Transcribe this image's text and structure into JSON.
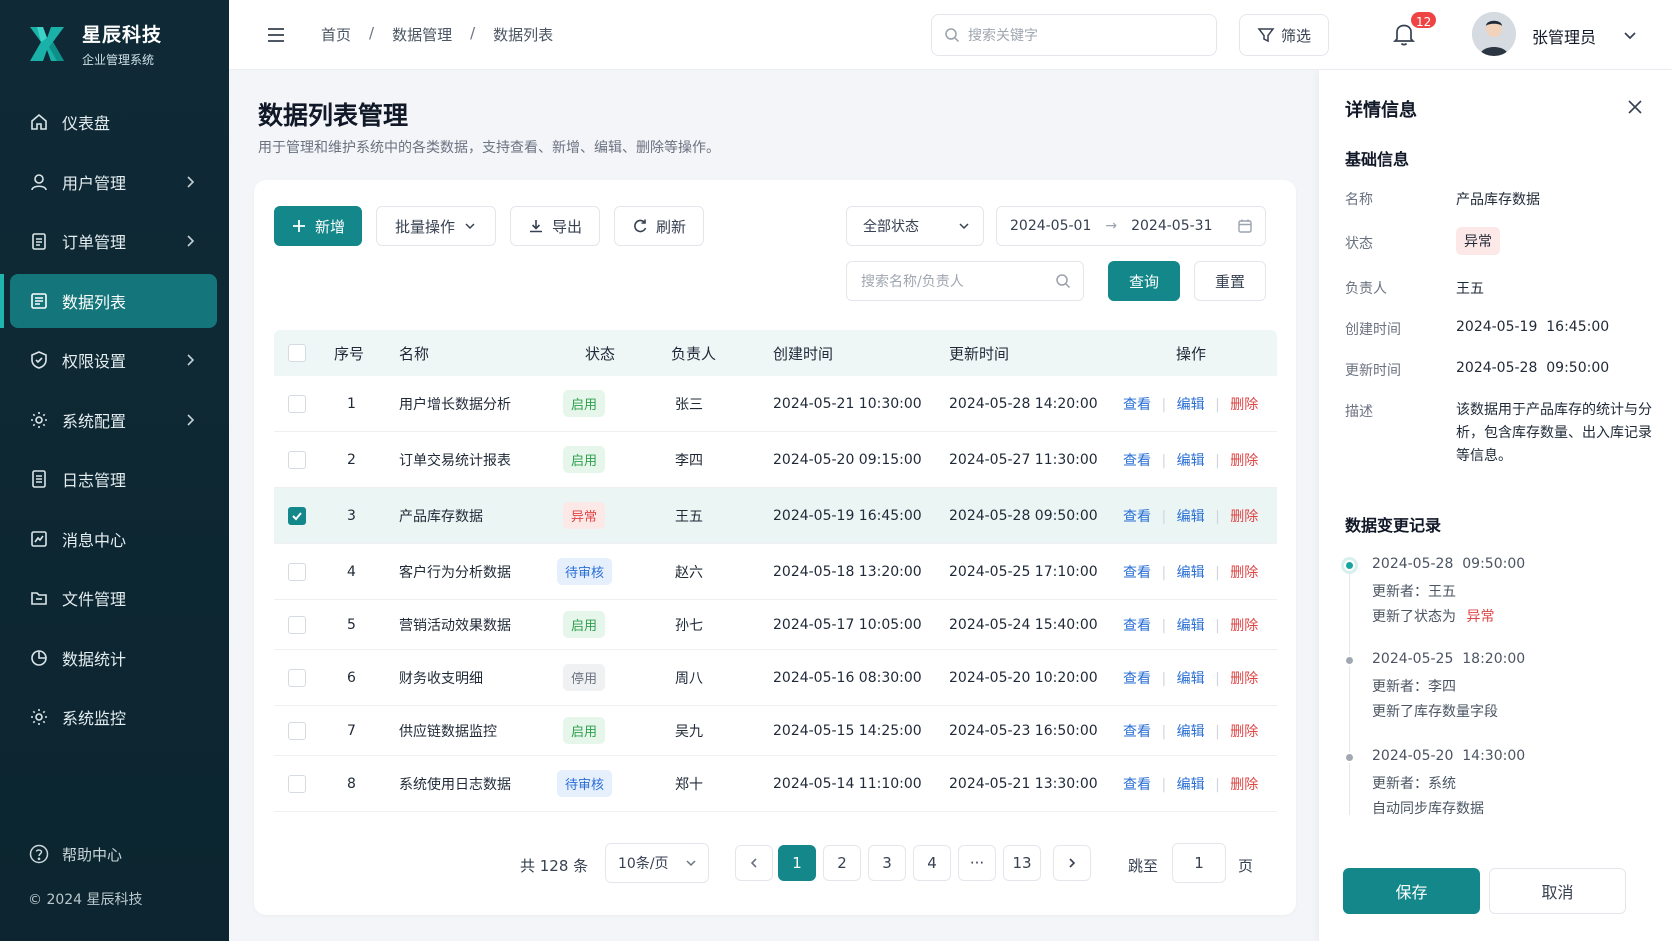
{
  "brand": {
    "name": "星辰科技",
    "subtitle": "企业管理系统"
  },
  "sidebar": {
    "items": [
      {
        "label": "仪表盘",
        "icon": "home-icon",
        "has_children": false,
        "active": false
      },
      {
        "label": "用户管理",
        "icon": "user-icon",
        "has_children": true,
        "active": false
      },
      {
        "label": "订单管理",
        "icon": "clipboard-icon",
        "has_children": true,
        "active": false
      },
      {
        "label": "数据列表",
        "icon": "list-icon",
        "has_children": false,
        "active": true
      },
      {
        "label": "权限设置",
        "icon": "shield-icon",
        "has_children": true,
        "active": false
      },
      {
        "label": "系统配置",
        "icon": "gear-icon",
        "has_children": true,
        "active": false
      },
      {
        "label": "日志管理",
        "icon": "document-icon",
        "has_children": false,
        "active": false
      },
      {
        "label": "消息中心",
        "icon": "chart-line-icon",
        "has_children": false,
        "active": false
      },
      {
        "label": "文件管理",
        "icon": "folder-icon",
        "has_children": false,
        "active": false
      },
      {
        "label": "数据统计",
        "icon": "pie-chart-icon",
        "has_children": false,
        "active": false
      },
      {
        "label": "系统监控",
        "icon": "monitor-gear-icon",
        "has_children": false,
        "active": false
      }
    ],
    "help_label": "帮助中心",
    "copyright": "© 2024 星辰科技"
  },
  "header": {
    "breadcrumb": [
      "首页",
      "数据管理",
      "数据列表"
    ],
    "search_placeholder": "搜索关键字",
    "filter_label": "筛选",
    "notification_count": "12",
    "user_name": "张管理员"
  },
  "page": {
    "title": "数据列表管理",
    "description": "用于管理和维护系统中的各类数据，支持查看、新增、编辑、删除等操作。"
  },
  "toolbar": {
    "add_label": "新增",
    "batch_label": "批量操作",
    "export_label": "导出",
    "refresh_label": "刷新",
    "status_select": "全部状态",
    "date_start": "2024-05-01",
    "date_end": "2024-05-31",
    "search_placeholder": "搜索名称/负责人",
    "query_label": "查询",
    "reset_label": "重置"
  },
  "table": {
    "columns": [
      "序号",
      "名称",
      "状态",
      "负责人",
      "创建时间",
      "更新时间",
      "操作"
    ],
    "actions": {
      "view": "查看",
      "edit": "编辑",
      "delete": "删除"
    },
    "rows": [
      {
        "index": "1",
        "name": "用户增长数据分析",
        "status": "启用",
        "status_type": "green",
        "owner": "张三",
        "created": "2024-05-21 10:30:00",
        "updated": "2024-05-28 14:20:00",
        "checked": false
      },
      {
        "index": "2",
        "name": "订单交易统计报表",
        "status": "启用",
        "status_type": "green",
        "owner": "李四",
        "created": "2024-05-20 09:15:00",
        "updated": "2024-05-27 11:30:00",
        "checked": false
      },
      {
        "index": "3",
        "name": "产品库存数据",
        "status": "异常",
        "status_type": "red",
        "owner": "王五",
        "created": "2024-05-19 16:45:00",
        "updated": "2024-05-28 09:50:00",
        "checked": true
      },
      {
        "index": "4",
        "name": "客户行为分析数据",
        "status": "待审核",
        "status_type": "blue",
        "owner": "赵六",
        "created": "2024-05-18 13:20:00",
        "updated": "2024-05-25 17:10:00",
        "checked": false
      },
      {
        "index": "5",
        "name": "营销活动效果数据",
        "status": "启用",
        "status_type": "green",
        "owner": "孙七",
        "created": "2024-05-17 10:05:00",
        "updated": "2024-05-24 15:40:00",
        "checked": false
      },
      {
        "index": "6",
        "name": "财务收支明细",
        "status": "停用",
        "status_type": "gray",
        "owner": "周八",
        "created": "2024-05-16 08:30:00",
        "updated": "2024-05-20 10:20:00",
        "checked": false
      },
      {
        "index": "7",
        "name": "供应链数据监控",
        "status": "启用",
        "status_type": "green",
        "owner": "吴九",
        "created": "2024-05-15 14:25:00",
        "updated": "2024-05-23 16:50:00",
        "checked": false
      },
      {
        "index": "8",
        "name": "系统使用日志数据",
        "status": "待审核",
        "status_type": "blue",
        "owner": "郑十",
        "created": "2024-05-14 11:10:00",
        "updated": "2024-05-21 13:30:00",
        "checked": false
      }
    ]
  },
  "pagination": {
    "total_text": "共 128 条",
    "page_size": "10条/页",
    "pages": [
      "1",
      "2",
      "3",
      "4",
      "···",
      "13"
    ],
    "current": "1",
    "jump_label": "跳至",
    "jump_value": "1",
    "jump_unit": "页"
  },
  "detail": {
    "title": "详情信息",
    "basic_title": "基础信息",
    "fields": [
      {
        "label": "名称",
        "value": "产品库存数据"
      },
      {
        "label": "状态",
        "value": "异常"
      },
      {
        "label": "负责人",
        "value": "王五"
      },
      {
        "label": "创建时间",
        "value": "2024-05-19  16:45:00"
      },
      {
        "label": "更新时间",
        "value": "2024-05-28  09:50:00"
      },
      {
        "label": "描述",
        "value": "该数据用于产品库存的统计与分析，包含库存数量、出入库记录等信息。"
      }
    ],
    "history_title": "数据变更记录",
    "history": [
      {
        "time": "2024-05-28  09:50:00",
        "updater": "更新者：王五",
        "change": "更新了状态为",
        "change_highlight": "异常"
      },
      {
        "time": "2024-05-25  18:20:00",
        "updater": "更新者：李四",
        "change": "更新了库存数量字段",
        "change_highlight": ""
      },
      {
        "time": "2024-05-20  14:30:00",
        "updater": "更新者：系统",
        "change": "自动同步库存数据",
        "change_highlight": ""
      }
    ],
    "save_label": "保存",
    "cancel_label": "取消"
  },
  "colors": {
    "primary": "#13878a",
    "sidebar_bg": "#0f2a36",
    "danger": "#e04545",
    "link": "#2a6fd6"
  }
}
